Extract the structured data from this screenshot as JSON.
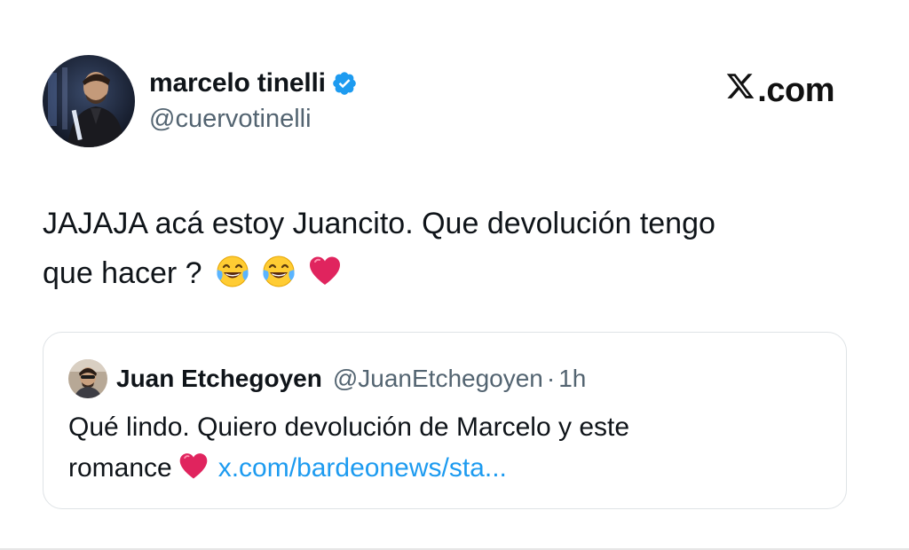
{
  "brand": {
    "logo_text": ".com",
    "logo_icon": "x-logo-icon"
  },
  "author": {
    "display_name": "marcelo tinelli",
    "handle": "@cuervotinelli",
    "verified_icon": "verified-badge-icon"
  },
  "tweet": {
    "line1": "JAJAJA acá estoy Juancito. Que devolución tengo",
    "line2": "que hacer ?",
    "emojis": [
      "laughing-crying-emoji",
      "laughing-crying-emoji",
      "red-heart-emoji"
    ]
  },
  "quote": {
    "display_name": "Juan Etchegoyen",
    "handle": "@JuanEtchegoyen",
    "separator": "·",
    "time": "1h",
    "line1": "Qué lindo. Quiero devolución de Marcelo y este",
    "line2_text": "romance",
    "link": "x.com/bardeonews/sta..."
  },
  "colors": {
    "text": "#0f1419",
    "secondary": "#536471",
    "link": "#1d9bf0",
    "verified": "#1d9bf0",
    "heart": "#e0245e"
  }
}
